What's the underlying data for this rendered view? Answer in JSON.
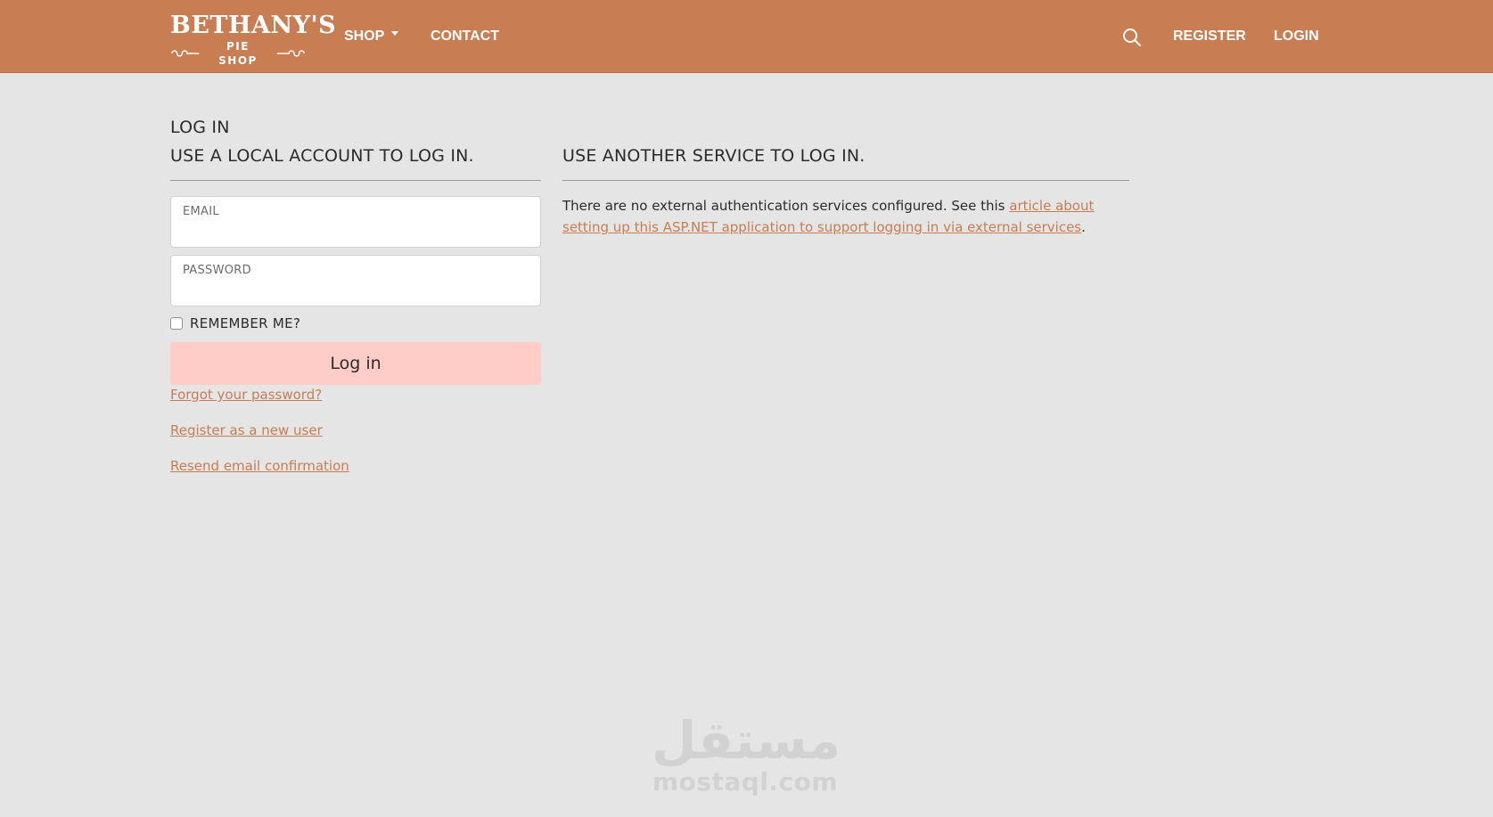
{
  "brand": {
    "name_top": "BETHANY'S",
    "name_bottom": "PIE SHOP"
  },
  "nav": {
    "shop_label": "SHOP",
    "contact_label": "CONTACT",
    "register_label": "REGISTER",
    "login_label": "LOGIN"
  },
  "page": {
    "title": "LOG IN",
    "local_heading": "USE A LOCAL ACCOUNT TO LOG IN.",
    "external_heading": "USE ANOTHER SERVICE TO LOG IN."
  },
  "form": {
    "email_label": "EMAIL",
    "email_value": "",
    "password_label": "PASSWORD",
    "password_value": "",
    "remember_label": "REMEMBER ME?",
    "remember_checked": false,
    "submit_label": "Log in"
  },
  "links": {
    "forgot": "Forgot your password?",
    "register": "Register as a new user",
    "resend": "Resend email confirmation"
  },
  "external": {
    "text_before": "There are no external authentication services configured. See this ",
    "link_text": "article about setting up this ASP.NET application to support logging in via external services",
    "text_after": "."
  },
  "watermark": {
    "arabic": "مستقل",
    "latin": "mostaql.com"
  },
  "colors": {
    "navbar": "#c87d53",
    "background": "#e5e5e5",
    "accent": "#c87d53",
    "button": "#ffcdc8"
  }
}
